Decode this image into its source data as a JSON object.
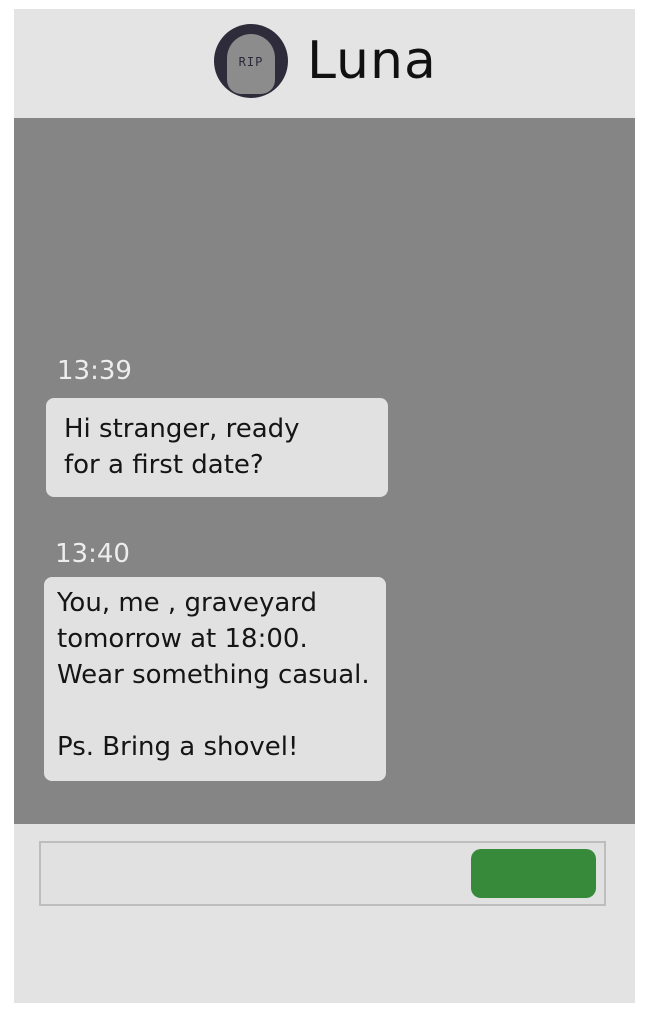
{
  "header": {
    "contact_name": "Luna",
    "avatar_icon": "tombstone-icon",
    "avatar_text": "RIP"
  },
  "messages": [
    {
      "time": "13:39",
      "text": "Hi stranger, ready\nfor a first date?"
    },
    {
      "time": "13:40",
      "text": "You, me , graveyard\ntomorrow at 18:00.\nWear something casual.\n\nPs. Bring a shovel!"
    }
  ],
  "composer": {
    "input_value": "",
    "send_button_color": "#388a3b"
  },
  "colors": {
    "chat_background": "#858585",
    "bubble_background": "#e1e1e1",
    "header_background": "#e4e4e4"
  }
}
